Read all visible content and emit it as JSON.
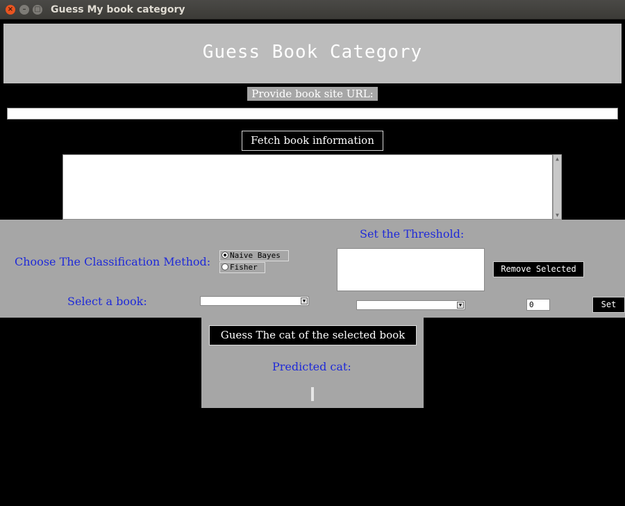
{
  "window": {
    "title": "Guess My book category",
    "controls": [
      "close-icon",
      "minimize-icon",
      "maximize-icon"
    ]
  },
  "header": {
    "title": "Guess Book Category"
  },
  "url": {
    "label": "Provide book site URL:",
    "value": ""
  },
  "fetch": {
    "label": "Fetch book information"
  },
  "book_info": {
    "value": ""
  },
  "classification": {
    "label": "Choose The Classification Method:",
    "options": [
      {
        "label": "Naive Bayes",
        "selected": true
      },
      {
        "label": "Fisher",
        "selected": false
      }
    ]
  },
  "threshold": {
    "label": "Set the Threshold:",
    "remove_label": "Remove Selected",
    "value": "0",
    "set_label": "Set",
    "category_selected": ""
  },
  "book_select": {
    "label": "Select a book:",
    "selected": ""
  },
  "guess": {
    "label": "Guess The cat of the selected book",
    "predicted_label": "Predicted cat:",
    "predicted_value": ""
  },
  "colors": {
    "label_blue": "#1f2ad8",
    "panel_gray": "#a6a6a6",
    "header_gray": "#bcbcbc",
    "background": "#000000"
  }
}
